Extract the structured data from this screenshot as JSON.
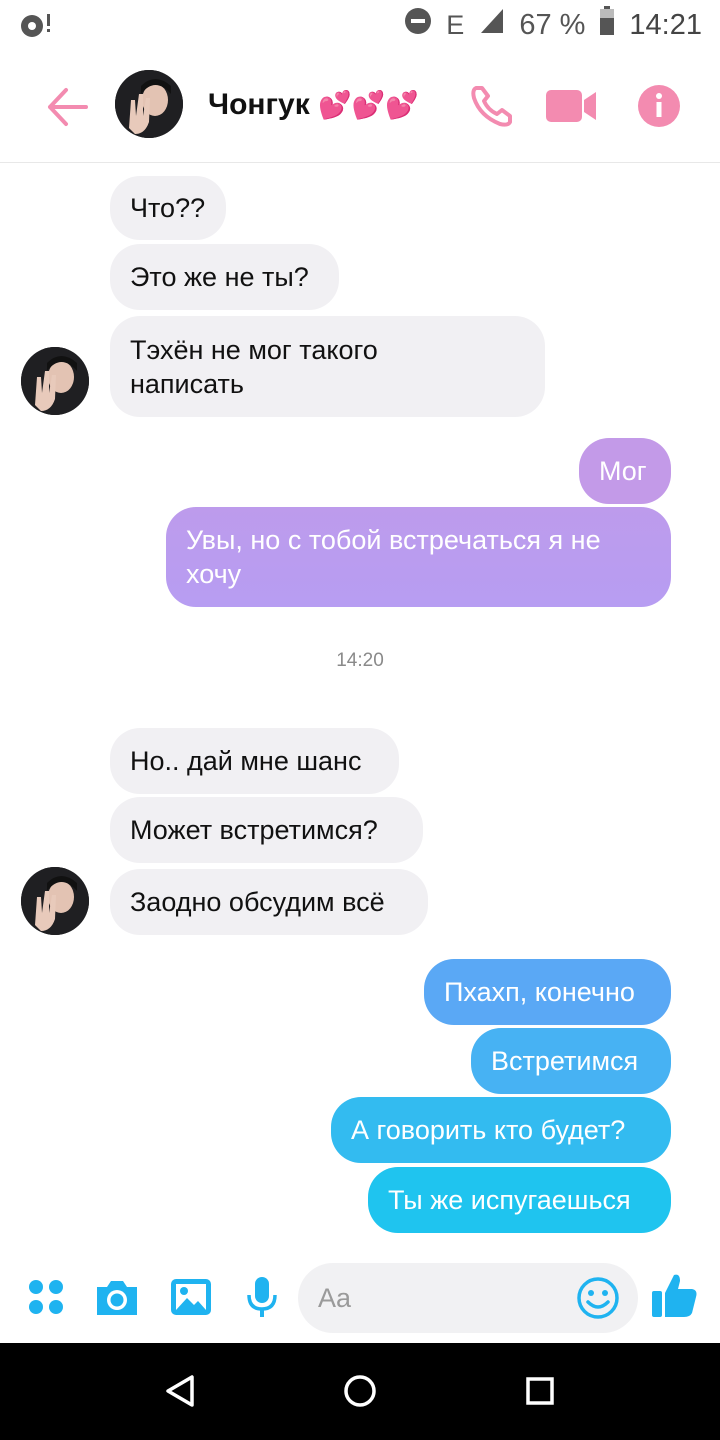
{
  "status_bar": {
    "network": "E",
    "battery_percent": "67 %",
    "time": "14:21"
  },
  "header": {
    "contact_name": "Чонгук",
    "name_emoji": "💕💕💕",
    "icons": [
      "back-arrow-icon",
      "phone-icon",
      "video-camera-icon",
      "info-icon"
    ],
    "accent_color": "#f38bb0"
  },
  "messages": [
    {
      "side": "incoming",
      "text": "Что??"
    },
    {
      "side": "incoming",
      "text": "Это же не ты?"
    },
    {
      "side": "incoming",
      "lines": [
        "Тэхён не мог такого",
        "написать"
      ]
    },
    {
      "side": "outgoing",
      "text": "Мог"
    },
    {
      "side": "outgoing",
      "lines": [
        "Увы, но с тобой встречаться я не",
        "хочу"
      ]
    },
    {
      "side": "incoming",
      "text": "Но.. дай мне шанс"
    },
    {
      "side": "incoming",
      "text": "Может встретимся?"
    },
    {
      "side": "incoming",
      "text": "Заодно обсудим всё"
    },
    {
      "side": "outgoing",
      "text": "Пхахп, конечно"
    },
    {
      "side": "outgoing",
      "text": "Встретимся"
    },
    {
      "side": "outgoing",
      "text": "А говорить кто будет?"
    },
    {
      "side": "outgoing",
      "text": "Ты же испугаешься"
    }
  ],
  "timestamp": "14:20",
  "composer": {
    "placeholder": "Aa",
    "icons": [
      "apps-grid-icon",
      "camera-icon",
      "gallery-icon",
      "microphone-icon",
      "emoji-icon",
      "thumbs-up-icon"
    ],
    "accent_color": "#1fb3f0"
  },
  "colors": {
    "incoming_bubble": "#f1f0f3",
    "purple_top": "#c39ae8",
    "purple_bottom": "#b79df2",
    "blue_top": "#5aa8f5",
    "blue_bottom": "#1fc4ef"
  },
  "nav_bar": {
    "icons": [
      "back-triangle-icon",
      "home-circle-icon",
      "recents-square-icon"
    ]
  }
}
